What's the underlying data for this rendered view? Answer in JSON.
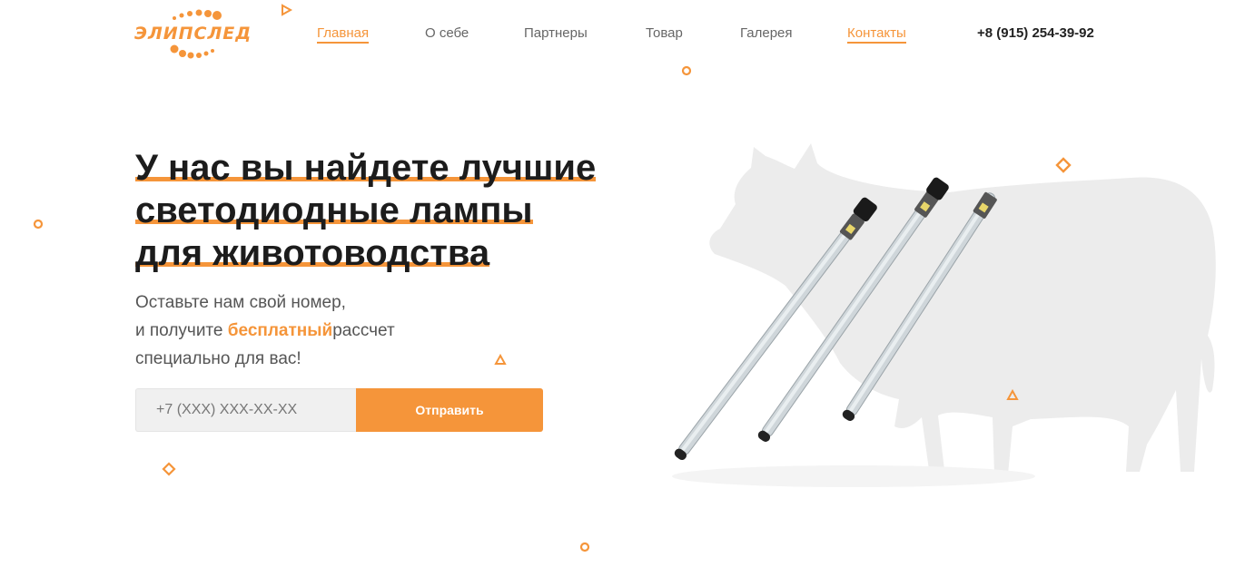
{
  "brand": {
    "logo_text": "ЭЛИПСЛЕД"
  },
  "nav": {
    "items": [
      {
        "label": "Главная",
        "active": true
      },
      {
        "label": "О себе",
        "active": false
      },
      {
        "label": "Партнеры",
        "active": false
      },
      {
        "label": "Товар",
        "active": false
      },
      {
        "label": "Галерея",
        "active": false
      },
      {
        "label": "Контакты",
        "active": true
      }
    ]
  },
  "header": {
    "phone": "+8 (915) 254-39-92"
  },
  "hero": {
    "title_lines": [
      "У нас вы найдете лучшие",
      "светодиодные лампы",
      "для животоводства"
    ],
    "subtitle_line1": "Оставьте нам свой номер,",
    "subtitle_line2_before": "и получите ",
    "subtitle_line2_accent": "бесплатный",
    "subtitle_line2_after": "рассчет",
    "subtitle_line3": "специально для вас!"
  },
  "form": {
    "phone_placeholder": "+7 (XXX) XXX-XX-XX",
    "phone_value": "",
    "submit_label": "Отправить"
  },
  "colors": {
    "accent": "#f5953a",
    "text": "#1c1c1c",
    "muted": "#555555"
  }
}
